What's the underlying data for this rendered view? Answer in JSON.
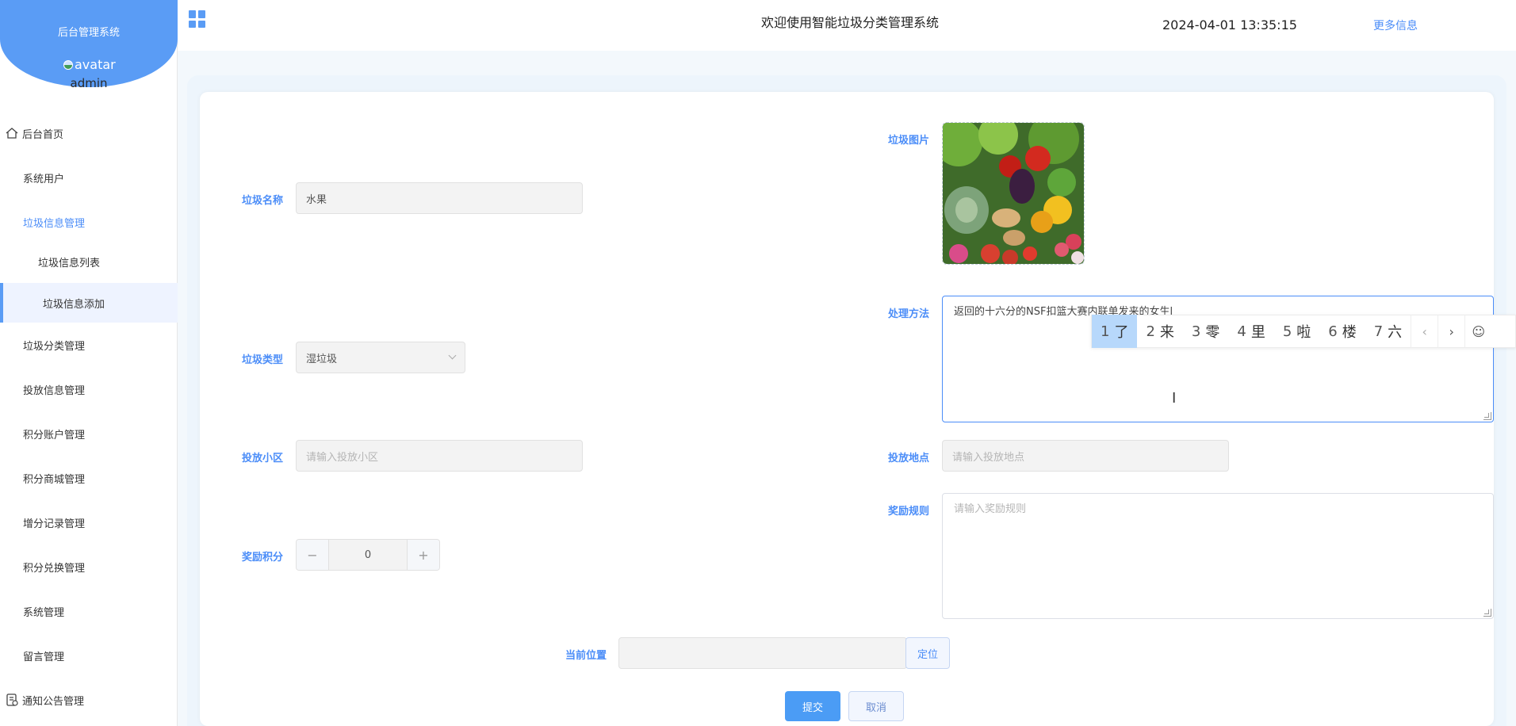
{
  "sidebar": {
    "system_title": "后台管理系统",
    "avatar_alt": "avatar",
    "username": "admin",
    "items": [
      {
        "label": "后台首页"
      },
      {
        "label": "系统用户"
      },
      {
        "label": "垃圾信息管理"
      },
      {
        "label": "垃圾信息列表"
      },
      {
        "label": "垃圾信息添加"
      },
      {
        "label": "垃圾分类管理"
      },
      {
        "label": "投放信息管理"
      },
      {
        "label": "积分账户管理"
      },
      {
        "label": "积分商城管理"
      },
      {
        "label": "增分记录管理"
      },
      {
        "label": "积分兑换管理"
      },
      {
        "label": "系统管理"
      },
      {
        "label": "留言管理"
      },
      {
        "label": "通知公告管理"
      }
    ]
  },
  "header": {
    "welcome": "欢迎使用智能垃圾分类管理系统",
    "datetime": "2024-04-01 13:35:15",
    "more_info": "更多信息"
  },
  "form": {
    "name_label": "垃圾名称",
    "name_value": "水果",
    "image_label": "垃圾图片",
    "method_label": "处理方法",
    "method_value": "返回的十六分的NSF扣篮大赛内联单发来的女生l",
    "type_label": "垃圾类型",
    "type_value": "湿垃圾",
    "community_label": "投放小区",
    "community_placeholder": "请输入投放小区",
    "location_label": "投放地点",
    "location_placeholder": "请输入投放地点",
    "reward_rule_label": "奖励规则",
    "reward_rule_placeholder": "请输入奖励规则",
    "points_label": "奖励积分",
    "points_value": "0",
    "points_minus": "−",
    "points_plus": "+",
    "position_label": "当前位置",
    "position_value": "",
    "locate_button": "定位",
    "submit_button": "提交",
    "cancel_button": "取消"
  },
  "ime": {
    "candidates": [
      {
        "num": "1",
        "text": "了"
      },
      {
        "num": "2",
        "text": "来"
      },
      {
        "num": "3",
        "text": "零"
      },
      {
        "num": "4",
        "text": "里"
      },
      {
        "num": "5",
        "text": "啦"
      },
      {
        "num": "6",
        "text": "楼"
      },
      {
        "num": "7",
        "text": "六"
      }
    ],
    "prev": "‹",
    "next": "›",
    "emoji": "☺"
  },
  "colors": {
    "accent": "#4b8df8",
    "logo_bg": "#5a9cf5",
    "submit_bg": "#4b9cf5"
  }
}
